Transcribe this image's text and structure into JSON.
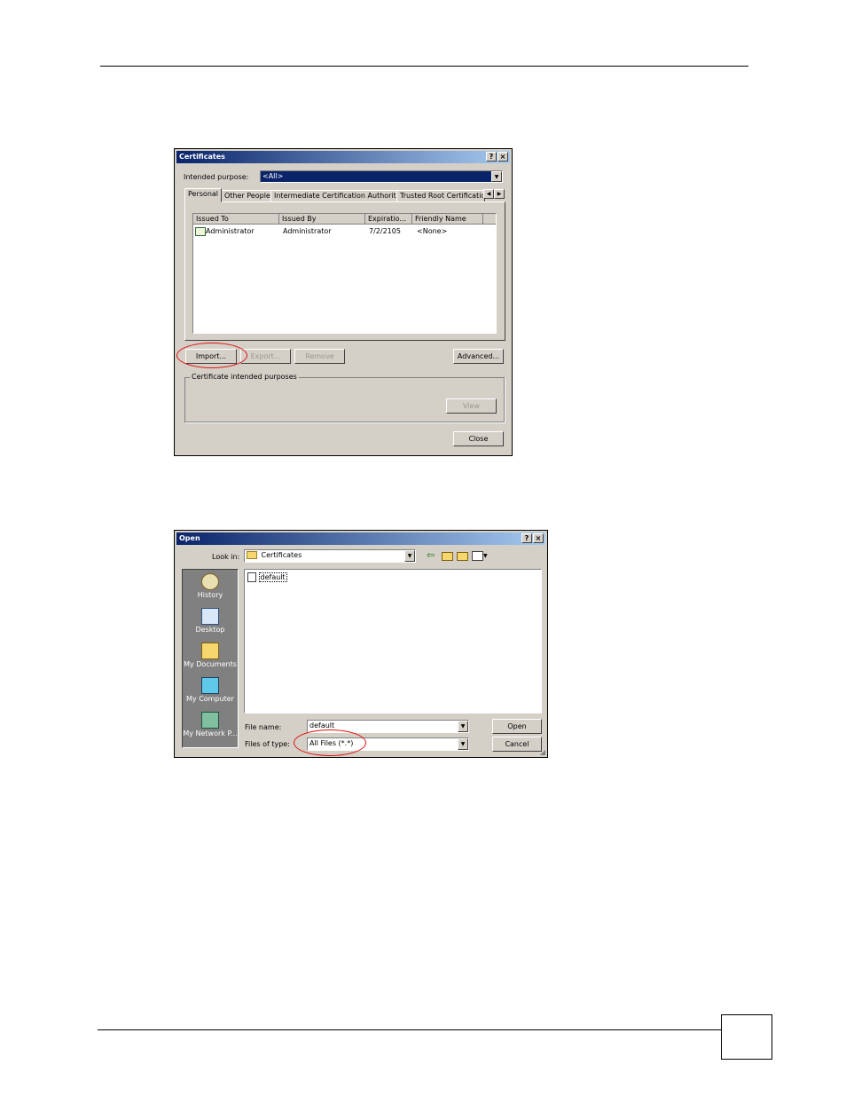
{
  "cert_dialog": {
    "title": "Certificates",
    "help_button": "?",
    "close_x": "×",
    "intended_purpose_label": "Intended purpose:",
    "intended_purpose_value": "<All>",
    "tabs": [
      "Personal",
      "Other People",
      "Intermediate Certification Authorities",
      "Trusted Root Certification"
    ],
    "columns": [
      "Issued To",
      "Issued By",
      "Expiratio...",
      "Friendly Name"
    ],
    "rows": [
      {
        "issued_to": "Administrator",
        "issued_by": "Administrator",
        "expiration": "7/2/2105",
        "friendly_name": "<None>"
      }
    ],
    "buttons": {
      "import": "Import...",
      "export": "Export...",
      "remove": "Remove",
      "advanced": "Advanced..."
    },
    "group_label": "Certificate intended purposes",
    "view_button": "View",
    "close_button": "Close"
  },
  "open_dialog": {
    "title": "Open",
    "help_button": "?",
    "close_x": "×",
    "look_in_label": "Look in:",
    "look_in_value": "Certificates",
    "places": [
      "History",
      "Desktop",
      "My Documents",
      "My Computer",
      "My Network P..."
    ],
    "files": [
      "default"
    ],
    "file_name_label": "File name:",
    "file_name_value": "default",
    "files_of_type_label": "Files of type:",
    "files_of_type_value": "All Files (*.*)",
    "open_button": "Open",
    "cancel_button": "Cancel"
  },
  "colors": {
    "title_start": "#0a246a",
    "title_end": "#a6caf0",
    "highlight": "#e01010",
    "face": "#d4d0c8"
  }
}
